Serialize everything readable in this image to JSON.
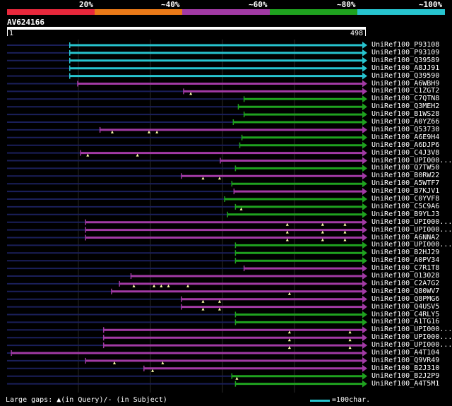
{
  "legend": {
    "labels": [
      "20%",
      "~40%",
      "~60%",
      "~80%",
      "~100%"
    ],
    "colors": [
      "#e8283c",
      "#ea7a18",
      "#a23aa5",
      "#1fa21f",
      "#27c4cf"
    ]
  },
  "query": {
    "id": "AV624166",
    "start": "1",
    "end": "498"
  },
  "footer": {
    "gaps_text": "Large gaps: ▲(in Query)/- (in Subject)",
    "scale_text": "=100char."
  },
  "hits": [
    {
      "label": "UniRef100_P93108",
      "color": "cyan",
      "start": 88,
      "gaps": []
    },
    {
      "label": "UniRef100_P93109",
      "color": "cyan",
      "start": 88,
      "gaps": []
    },
    {
      "label": "UniRef100_Q39589",
      "color": "cyan",
      "start": 88,
      "gaps": []
    },
    {
      "label": "UniRef100_A8JJ91",
      "color": "cyan",
      "start": 88,
      "gaps": []
    },
    {
      "label": "UniRef100_Q39590",
      "color": "cyan",
      "start": 88,
      "gaps": []
    },
    {
      "label": "UniRef100_A6WBH9",
      "color": "purple",
      "start": 99,
      "gaps": []
    },
    {
      "label": "UniRef100_C1ZGT2",
      "color": "purple",
      "start": 246,
      "gaps": [
        256
      ]
    },
    {
      "label": "UniRef100_C7QTN8",
      "color": "green",
      "start": 330,
      "gaps": []
    },
    {
      "label": "UniRef100_Q3MEH2",
      "color": "green",
      "start": 322,
      "gaps": []
    },
    {
      "label": "UniRef100_B1WS28",
      "color": "green",
      "start": 330,
      "gaps": []
    },
    {
      "label": "UniRef100_A0YZ66",
      "color": "green",
      "start": 315,
      "gaps": []
    },
    {
      "label": "UniRef100_Q53730",
      "color": "purple",
      "start": 130,
      "gaps": [
        147,
        198,
        209
      ]
    },
    {
      "label": "UniRef100_A6E9H4",
      "color": "green",
      "start": 327,
      "gaps": []
    },
    {
      "label": "UniRef100_A6DJP6",
      "color": "green",
      "start": 324,
      "gaps": []
    },
    {
      "label": "UniRef100_C4J3V8",
      "color": "purple",
      "start": 103,
      "gaps": [
        113,
        182
      ]
    },
    {
      "label": "UniRef100_UPI000...",
      "color": "purple",
      "start": 297,
      "gaps": []
    },
    {
      "label": "UniRef100_Q7TW50",
      "color": "green",
      "start": 318,
      "gaps": []
    },
    {
      "label": "UniRef100_B0RW22",
      "color": "purple",
      "start": 243,
      "gaps": [
        273,
        296
      ]
    },
    {
      "label": "UniRef100_A5WTF7",
      "color": "green",
      "start": 313,
      "gaps": []
    },
    {
      "label": "UniRef100_B7KJV1",
      "color": "purple",
      "start": 316,
      "gaps": []
    },
    {
      "label": "UniRef100_C0YVF8",
      "color": "green",
      "start": 303,
      "gaps": []
    },
    {
      "label": "UniRef100_C5C9A6",
      "color": "green",
      "start": 318,
      "gaps": [
        326
      ]
    },
    {
      "label": "UniRef100_B9YLJ3",
      "color": "green",
      "start": 307,
      "gaps": []
    },
    {
      "label": "UniRef100_UPI000...",
      "color": "purple",
      "start": 110,
      "gaps": [
        390,
        439,
        470
      ]
    },
    {
      "label": "UniRef100_UPI000...",
      "color": "purple",
      "start": 110,
      "gaps": [
        390,
        439,
        470
      ]
    },
    {
      "label": "UniRef100_A6NNA2",
      "color": "purple",
      "start": 110,
      "gaps": [
        390,
        439,
        470
      ]
    },
    {
      "label": "UniRef100_UPI000...",
      "color": "green",
      "start": 318,
      "gaps": []
    },
    {
      "label": "UniRef100_B2HJ29",
      "color": "green",
      "start": 318,
      "gaps": []
    },
    {
      "label": "UniRef100_A0PV34",
      "color": "green",
      "start": 318,
      "gaps": []
    },
    {
      "label": "UniRef100_C7R1T8",
      "color": "purple",
      "start": 330,
      "gaps": []
    },
    {
      "label": "UniRef100_O13028",
      "color": "purple",
      "start": 173,
      "gaps": []
    },
    {
      "label": "UniRef100_C2A7G2",
      "color": "purple",
      "start": 157,
      "gaps": [
        177,
        205,
        215,
        225,
        252
      ]
    },
    {
      "label": "UniRef100_Q80WV7",
      "color": "purple",
      "start": 146,
      "gaps": [
        393
      ]
    },
    {
      "label": "UniRef100_Q8PMG6",
      "color": "purple",
      "start": 243,
      "gaps": [
        273,
        296
      ]
    },
    {
      "label": "UniRef100_Q4USV5",
      "color": "purple",
      "start": 243,
      "gaps": [
        273,
        296
      ]
    },
    {
      "label": "UniRef100_C4RLY5",
      "color": "green",
      "start": 318,
      "gaps": []
    },
    {
      "label": "UniRef100_A1TG16",
      "color": "green",
      "start": 318,
      "gaps": []
    },
    {
      "label": "UniRef100_UPI000...",
      "color": "purple",
      "start": 135,
      "gaps": [
        393,
        477
      ]
    },
    {
      "label": "UniRef100_UPI000...",
      "color": "purple",
      "start": 135,
      "gaps": [
        393,
        477
      ]
    },
    {
      "label": "UniRef100_UPI000...",
      "color": "purple",
      "start": 135,
      "gaps": [
        393,
        477
      ]
    },
    {
      "label": "UniRef100_A4T104",
      "color": "purple",
      "start": 7,
      "gaps": []
    },
    {
      "label": "UniRef100_Q9VR49",
      "color": "purple",
      "start": 110,
      "gaps": [
        150,
        217
      ]
    },
    {
      "label": "UniRef100_B2J310",
      "color": "purple",
      "start": 191,
      "gaps": [
        203
      ]
    },
    {
      "label": "UniRef100_B2J2P9",
      "color": "green",
      "start": 313,
      "gaps": [
        320
      ]
    },
    {
      "label": "UniRef100_A4T5M1",
      "color": "green",
      "start": 318,
      "gaps": []
    }
  ]
}
